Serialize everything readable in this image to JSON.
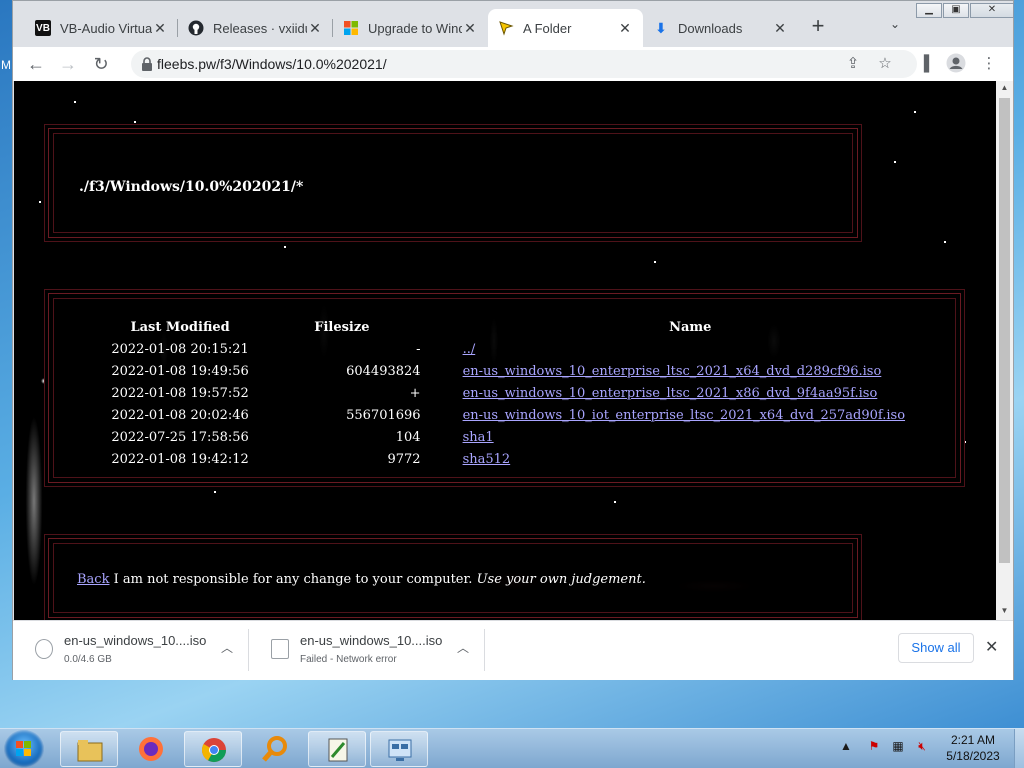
{
  "desktop": {
    "edge_letter": "M"
  },
  "browser": {
    "tabs": [
      {
        "title": "VB-Audio Virtual",
        "favicon": "vb-audio-icon"
      },
      {
        "title": "Releases · vxiidu",
        "favicon": "github-icon"
      },
      {
        "title": "Upgrade to Wind",
        "favicon": "microsoft-icon"
      },
      {
        "title": "A Folder",
        "favicon": "folder-arrow-icon",
        "active": true
      },
      {
        "title": "Downloads",
        "favicon": "download-icon"
      }
    ],
    "url": "fleebs.pw/f3/Windows/10.0%202021/"
  },
  "page": {
    "path_heading": "./f3/Windows/10.0%202021/*",
    "columns": [
      "Last Modified",
      "Filesize",
      "Name"
    ],
    "rows": [
      {
        "modified": "2022-01-08 20:15:21",
        "size": "-",
        "name": "../"
      },
      {
        "modified": "2022-01-08 19:49:56",
        "size": "604493824",
        "name": "en-us_windows_10_enterprise_ltsc_2021_x64_dvd_d289cf96.iso"
      },
      {
        "modified": "2022-01-08 19:57:52",
        "size": "+",
        "name": "en-us_windows_10_enterprise_ltsc_2021_x86_dvd_9f4aa95f.iso"
      },
      {
        "modified": "2022-01-08 20:02:46",
        "size": "556701696",
        "name": "en-us_windows_10_iot_enterprise_ltsc_2021_x64_dvd_257ad90f.iso"
      },
      {
        "modified": "2022-07-25 17:58:56",
        "size": "104",
        "name": "sha1"
      },
      {
        "modified": "2022-01-08 19:42:12",
        "size": "9772",
        "name": "sha512"
      }
    ],
    "footer": {
      "back_link": "Back",
      "notice": " I am not responsible for any change to your computer. ",
      "emphasis": "Use your own judgement."
    }
  },
  "downloads": {
    "items": [
      {
        "filename": "en-us_windows_10....iso",
        "status": "0.0/4.6 GB"
      },
      {
        "filename": "en-us_windows_10....iso",
        "status": "Failed - Network error"
      }
    ],
    "show_all": "Show all"
  },
  "taskbar": {
    "time": "2:21 AM",
    "date": "5/18/2023"
  },
  "colors": {
    "link": "#a9a5ff",
    "panel_border": "#6a1a22",
    "accent_blue": "#1a73e8"
  }
}
